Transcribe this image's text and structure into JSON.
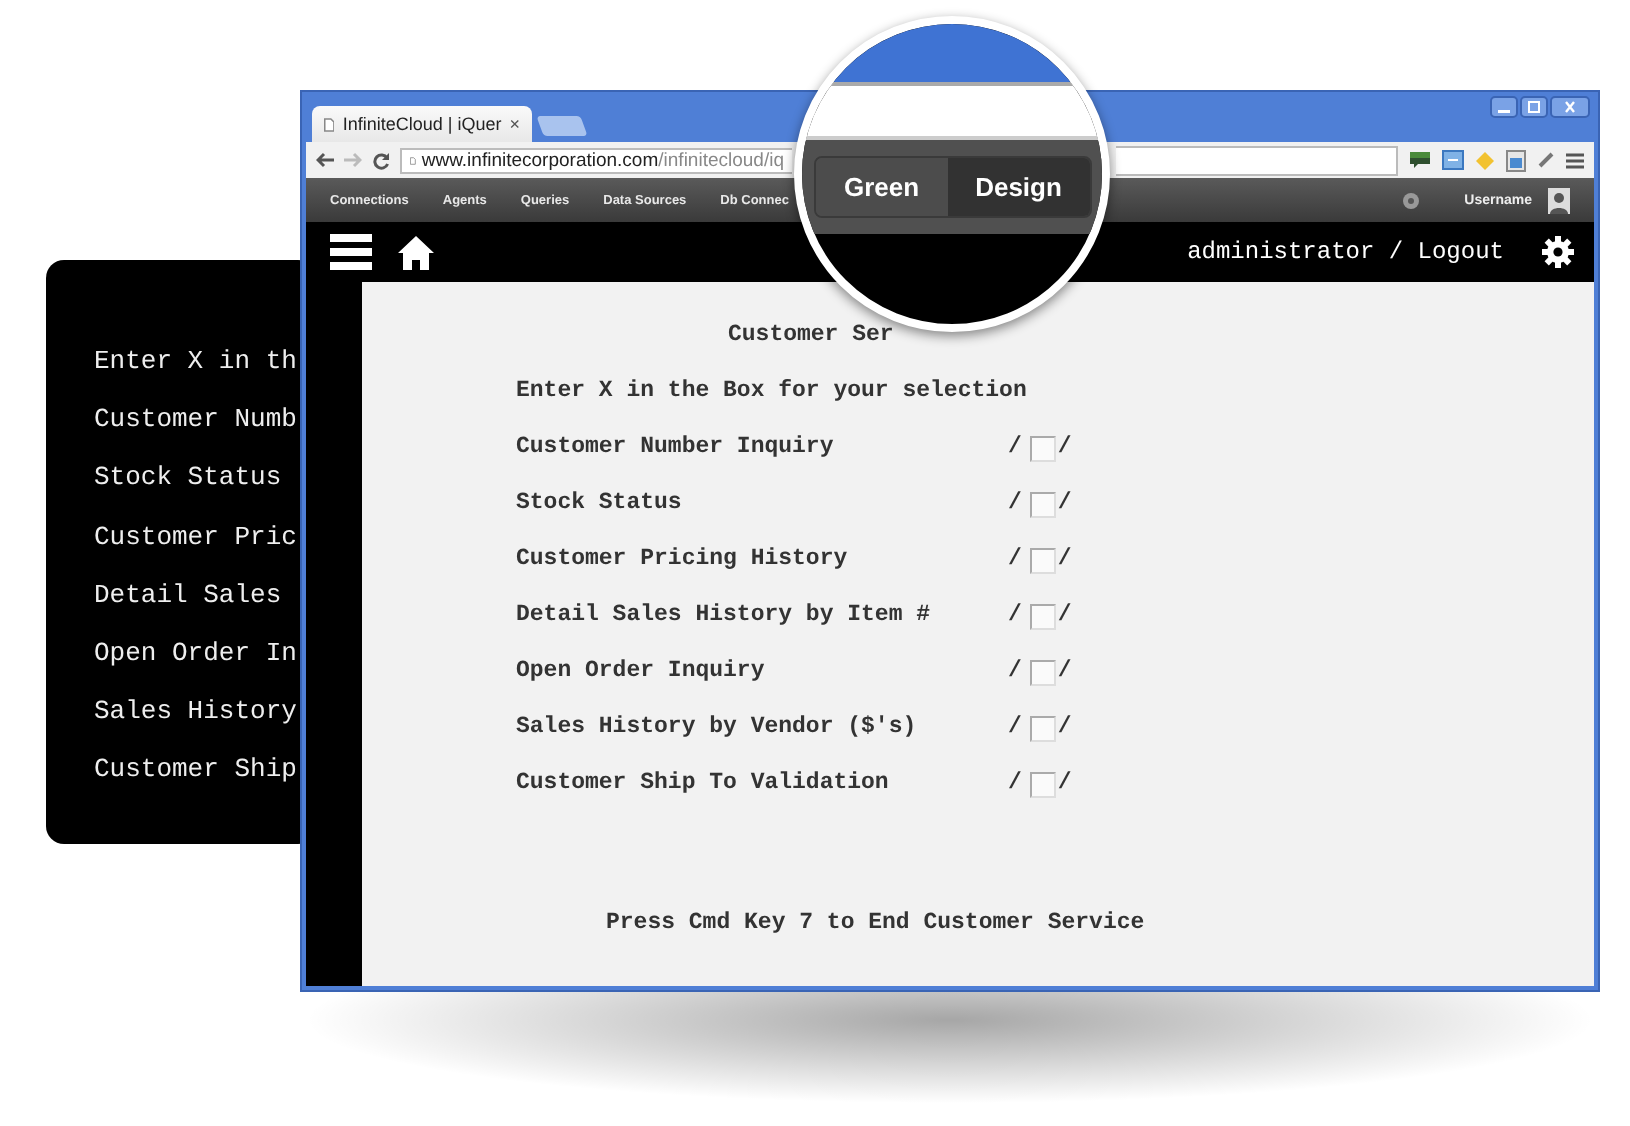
{
  "terminal_card": {
    "lines": [
      "Enter X in th",
      "Customer Numb",
      "Stock Status",
      "Customer Pric",
      "Detail Sales",
      "Open Order In",
      "Sales History",
      "Customer Ship"
    ]
  },
  "browser": {
    "tab": {
      "title": "InfiniteCloud | iQuer",
      "close": "×"
    },
    "address": {
      "host": "www.infinitecorporation.com",
      "path": "/infinitecloud/iq"
    },
    "nav": {
      "items": [
        "Connections",
        "Agents",
        "Queries",
        "Data Sources",
        "Db Connec"
      ],
      "username": "Username"
    },
    "header": {
      "user_link": "administrator / Logout"
    }
  },
  "screen": {
    "title": "Customer Ser",
    "instruction": "Enter X in the Box for your selection",
    "options": [
      {
        "label": "Customer Number Inquiry",
        "left_mark": "/",
        "right_mark": "/",
        "checked": false
      },
      {
        "label": "Stock Status",
        "left_mark": "/",
        "right_mark": "/",
        "checked": false
      },
      {
        "label": "Customer Pricing History",
        "left_mark": "/",
        "right_mark": "/",
        "checked": false
      },
      {
        "label": "Detail Sales History by Item #",
        "left_mark": "/",
        "right_mark": "/",
        "checked": false
      },
      {
        "label": "Open Order Inquiry",
        "left_mark": "/",
        "right_mark": "/",
        "checked": false
      },
      {
        "label": "Sales History by Vendor ($'s)",
        "left_mark": "/",
        "right_mark": "/",
        "checked": false
      },
      {
        "label": "Customer Ship To Validation",
        "left_mark": "/",
        "right_mark": "/",
        "checked": false
      }
    ],
    "footer": "Press Cmd Key 7 to End Customer Service"
  },
  "magnifier": {
    "toggle": [
      {
        "label": "Green",
        "selected": false
      },
      {
        "label": "Design",
        "selected": true
      }
    ]
  }
}
